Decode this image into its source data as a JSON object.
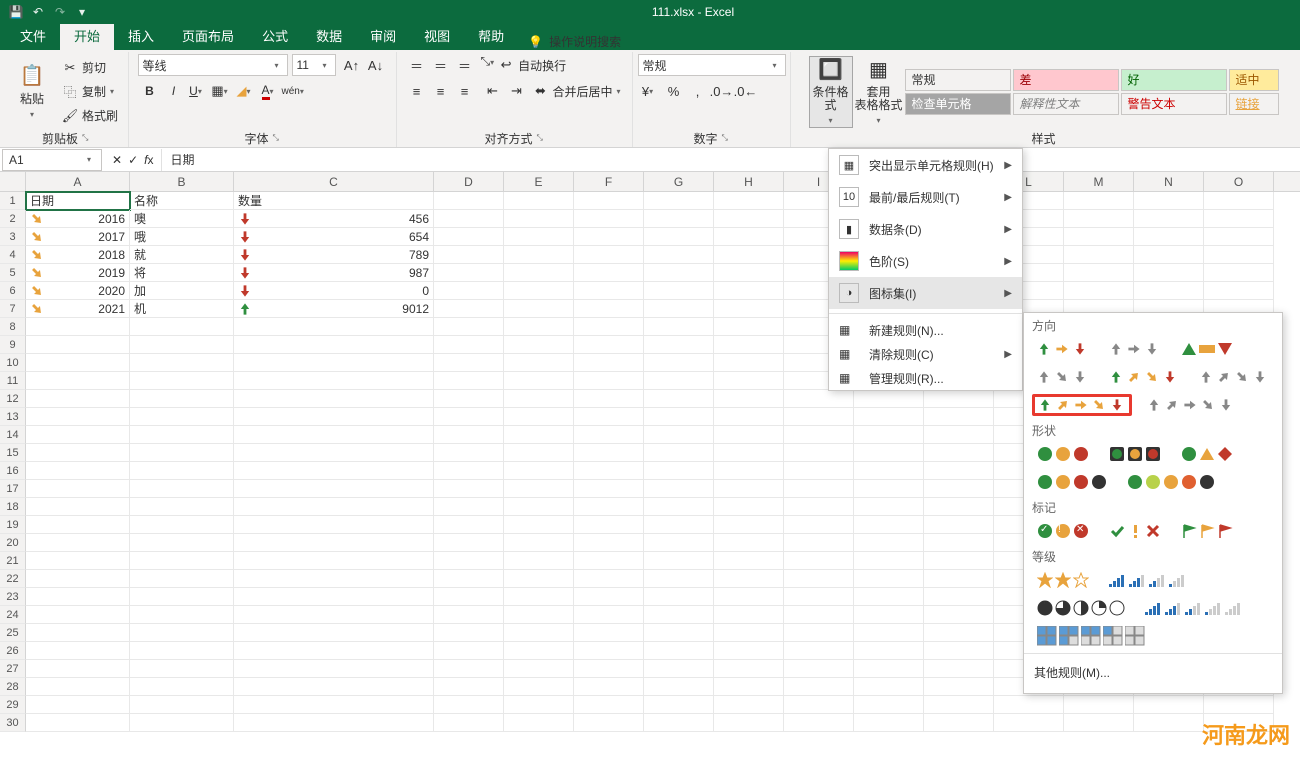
{
  "titlebar": {
    "doc": "111.xlsx - Excel"
  },
  "tabs": {
    "file": "文件",
    "home": "开始",
    "insert": "插入",
    "layout": "页面布局",
    "formulas": "公式",
    "data": "数据",
    "review": "审阅",
    "view": "视图",
    "help": "帮助",
    "tell": "操作说明搜索"
  },
  "ribbon": {
    "clipboard": {
      "paste": "粘贴",
      "cut": "剪切",
      "copy": "复制",
      "painter": "格式刷",
      "label": "剪贴板"
    },
    "font": {
      "name": "等线",
      "size": "11",
      "label": "字体"
    },
    "align": {
      "wrap": "自动换行",
      "merge": "合并后居中",
      "label": "对齐方式"
    },
    "number": {
      "format": "常规",
      "label": "数字"
    },
    "styles": {
      "cond": "条件格式",
      "table": "套用\n表格格式",
      "label": "样式",
      "normal": "常规",
      "bad": "差",
      "good": "好",
      "neutral": "适中",
      "check": "检查单元格",
      "explain": "解释性文本",
      "warn": "警告文本",
      "link": "链接"
    }
  },
  "cf_menu": {
    "highlight": "突出显示单元格规则(H)",
    "top": "最前/最后规则(T)",
    "databars": "数据条(D)",
    "colorscales": "色阶(S)",
    "iconsets": "图标集(I)",
    "newrule": "新建规则(N)...",
    "clear": "清除规则(C)",
    "manage": "管理规则(R)..."
  },
  "iconset": {
    "direction": "方向",
    "shapes": "形状",
    "indicators": "标记",
    "ratings": "等级",
    "other": "其他规则(M)..."
  },
  "namebox": "A1",
  "formula": "日期",
  "columns": [
    "A",
    "B",
    "C",
    "D",
    "E",
    "F",
    "G",
    "H",
    "I",
    "J",
    "K",
    "L",
    "M",
    "N",
    "O"
  ],
  "headers": {
    "a": "日期",
    "b": "名称",
    "c": "数量"
  },
  "data_rows": [
    {
      "a": "2016",
      "b": "噢",
      "c": "456",
      "ai": "y",
      "ci": "r"
    },
    {
      "a": "2017",
      "b": "哦",
      "c": "654",
      "ai": "y",
      "ci": "r"
    },
    {
      "a": "2018",
      "b": "就",
      "c": "789",
      "ai": "y",
      "ci": "r"
    },
    {
      "a": "2019",
      "b": "将",
      "c": "987",
      "ai": "y",
      "ci": "r"
    },
    {
      "a": "2020",
      "b": "加",
      "c": "0",
      "ai": "y",
      "ci": "r"
    },
    {
      "a": "2021",
      "b": "机",
      "c": "9012",
      "ai": "y",
      "ci": "g"
    }
  ],
  "watermark": "河南龙网"
}
